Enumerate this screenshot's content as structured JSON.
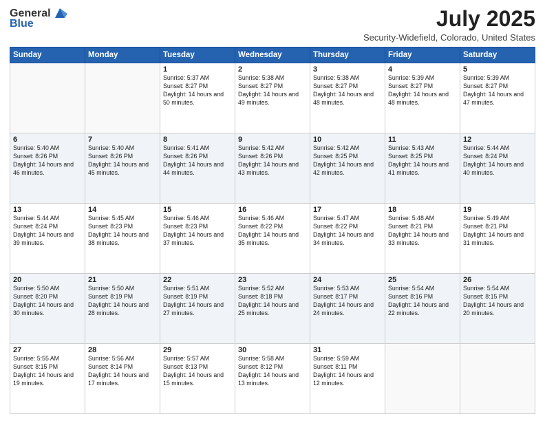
{
  "header": {
    "logo_general": "General",
    "logo_blue": "Blue",
    "title": "July 2025",
    "subtitle": "Security-Widefield, Colorado, United States"
  },
  "weekdays": [
    "Sunday",
    "Monday",
    "Tuesday",
    "Wednesday",
    "Thursday",
    "Friday",
    "Saturday"
  ],
  "weeks": [
    [
      {
        "day": "",
        "sunrise": "",
        "sunset": "",
        "daylight": ""
      },
      {
        "day": "",
        "sunrise": "",
        "sunset": "",
        "daylight": ""
      },
      {
        "day": "1",
        "sunrise": "Sunrise: 5:37 AM",
        "sunset": "Sunset: 8:27 PM",
        "daylight": "Daylight: 14 hours and 50 minutes."
      },
      {
        "day": "2",
        "sunrise": "Sunrise: 5:38 AM",
        "sunset": "Sunset: 8:27 PM",
        "daylight": "Daylight: 14 hours and 49 minutes."
      },
      {
        "day": "3",
        "sunrise": "Sunrise: 5:38 AM",
        "sunset": "Sunset: 8:27 PM",
        "daylight": "Daylight: 14 hours and 48 minutes."
      },
      {
        "day": "4",
        "sunrise": "Sunrise: 5:39 AM",
        "sunset": "Sunset: 8:27 PM",
        "daylight": "Daylight: 14 hours and 48 minutes."
      },
      {
        "day": "5",
        "sunrise": "Sunrise: 5:39 AM",
        "sunset": "Sunset: 8:27 PM",
        "daylight": "Daylight: 14 hours and 47 minutes."
      }
    ],
    [
      {
        "day": "6",
        "sunrise": "Sunrise: 5:40 AM",
        "sunset": "Sunset: 8:26 PM",
        "daylight": "Daylight: 14 hours and 46 minutes."
      },
      {
        "day": "7",
        "sunrise": "Sunrise: 5:40 AM",
        "sunset": "Sunset: 8:26 PM",
        "daylight": "Daylight: 14 hours and 45 minutes."
      },
      {
        "day": "8",
        "sunrise": "Sunrise: 5:41 AM",
        "sunset": "Sunset: 8:26 PM",
        "daylight": "Daylight: 14 hours and 44 minutes."
      },
      {
        "day": "9",
        "sunrise": "Sunrise: 5:42 AM",
        "sunset": "Sunset: 8:26 PM",
        "daylight": "Daylight: 14 hours and 43 minutes."
      },
      {
        "day": "10",
        "sunrise": "Sunrise: 5:42 AM",
        "sunset": "Sunset: 8:25 PM",
        "daylight": "Daylight: 14 hours and 42 minutes."
      },
      {
        "day": "11",
        "sunrise": "Sunrise: 5:43 AM",
        "sunset": "Sunset: 8:25 PM",
        "daylight": "Daylight: 14 hours and 41 minutes."
      },
      {
        "day": "12",
        "sunrise": "Sunrise: 5:44 AM",
        "sunset": "Sunset: 8:24 PM",
        "daylight": "Daylight: 14 hours and 40 minutes."
      }
    ],
    [
      {
        "day": "13",
        "sunrise": "Sunrise: 5:44 AM",
        "sunset": "Sunset: 8:24 PM",
        "daylight": "Daylight: 14 hours and 39 minutes."
      },
      {
        "day": "14",
        "sunrise": "Sunrise: 5:45 AM",
        "sunset": "Sunset: 8:23 PM",
        "daylight": "Daylight: 14 hours and 38 minutes."
      },
      {
        "day": "15",
        "sunrise": "Sunrise: 5:46 AM",
        "sunset": "Sunset: 8:23 PM",
        "daylight": "Daylight: 14 hours and 37 minutes."
      },
      {
        "day": "16",
        "sunrise": "Sunrise: 5:46 AM",
        "sunset": "Sunset: 8:22 PM",
        "daylight": "Daylight: 14 hours and 35 minutes."
      },
      {
        "day": "17",
        "sunrise": "Sunrise: 5:47 AM",
        "sunset": "Sunset: 8:22 PM",
        "daylight": "Daylight: 14 hours and 34 minutes."
      },
      {
        "day": "18",
        "sunrise": "Sunrise: 5:48 AM",
        "sunset": "Sunset: 8:21 PM",
        "daylight": "Daylight: 14 hours and 33 minutes."
      },
      {
        "day": "19",
        "sunrise": "Sunrise: 5:49 AM",
        "sunset": "Sunset: 8:21 PM",
        "daylight": "Daylight: 14 hours and 31 minutes."
      }
    ],
    [
      {
        "day": "20",
        "sunrise": "Sunrise: 5:50 AM",
        "sunset": "Sunset: 8:20 PM",
        "daylight": "Daylight: 14 hours and 30 minutes."
      },
      {
        "day": "21",
        "sunrise": "Sunrise: 5:50 AM",
        "sunset": "Sunset: 8:19 PM",
        "daylight": "Daylight: 14 hours and 28 minutes."
      },
      {
        "day": "22",
        "sunrise": "Sunrise: 5:51 AM",
        "sunset": "Sunset: 8:19 PM",
        "daylight": "Daylight: 14 hours and 27 minutes."
      },
      {
        "day": "23",
        "sunrise": "Sunrise: 5:52 AM",
        "sunset": "Sunset: 8:18 PM",
        "daylight": "Daylight: 14 hours and 25 minutes."
      },
      {
        "day": "24",
        "sunrise": "Sunrise: 5:53 AM",
        "sunset": "Sunset: 8:17 PM",
        "daylight": "Daylight: 14 hours and 24 minutes."
      },
      {
        "day": "25",
        "sunrise": "Sunrise: 5:54 AM",
        "sunset": "Sunset: 8:16 PM",
        "daylight": "Daylight: 14 hours and 22 minutes."
      },
      {
        "day": "26",
        "sunrise": "Sunrise: 5:54 AM",
        "sunset": "Sunset: 8:15 PM",
        "daylight": "Daylight: 14 hours and 20 minutes."
      }
    ],
    [
      {
        "day": "27",
        "sunrise": "Sunrise: 5:55 AM",
        "sunset": "Sunset: 8:15 PM",
        "daylight": "Daylight: 14 hours and 19 minutes."
      },
      {
        "day": "28",
        "sunrise": "Sunrise: 5:56 AM",
        "sunset": "Sunset: 8:14 PM",
        "daylight": "Daylight: 14 hours and 17 minutes."
      },
      {
        "day": "29",
        "sunrise": "Sunrise: 5:57 AM",
        "sunset": "Sunset: 8:13 PM",
        "daylight": "Daylight: 14 hours and 15 minutes."
      },
      {
        "day": "30",
        "sunrise": "Sunrise: 5:58 AM",
        "sunset": "Sunset: 8:12 PM",
        "daylight": "Daylight: 14 hours and 13 minutes."
      },
      {
        "day": "31",
        "sunrise": "Sunrise: 5:59 AM",
        "sunset": "Sunset: 8:11 PM",
        "daylight": "Daylight: 14 hours and 12 minutes."
      },
      {
        "day": "",
        "sunrise": "",
        "sunset": "",
        "daylight": ""
      },
      {
        "day": "",
        "sunrise": "",
        "sunset": "",
        "daylight": ""
      }
    ]
  ]
}
